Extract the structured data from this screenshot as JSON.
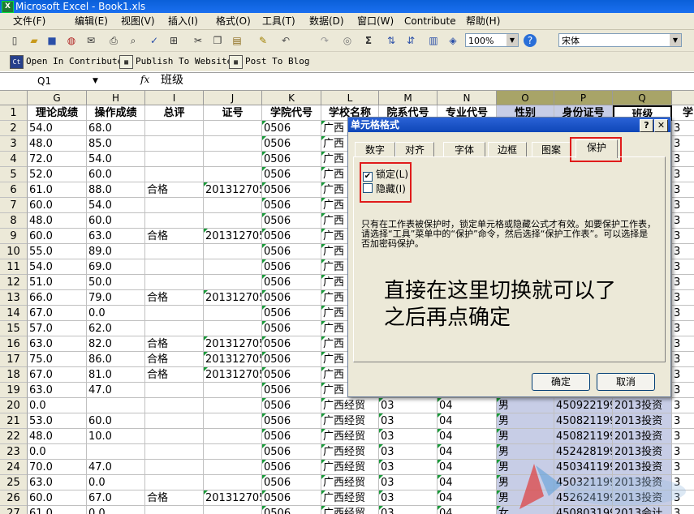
{
  "window": {
    "title": "Microsoft Excel - Book1.xls"
  },
  "menubar": [
    "文件(F)",
    "编辑(E)",
    "视图(V)",
    "插入(I)",
    "格式(O)",
    "工具(T)",
    "数据(D)",
    "窗口(W)",
    "Contribute",
    "帮助(H)"
  ],
  "toolbar": {
    "zoom": "100%",
    "font": "宋体",
    "contribute_buttons": [
      "Open In Contribute",
      "Publish To Website",
      "Post To Blog"
    ]
  },
  "formula_bar": {
    "name_box": "Q1",
    "fx": "fx",
    "value": "班级"
  },
  "grid": {
    "columns": [
      "G",
      "H",
      "I",
      "J",
      "K",
      "L",
      "M",
      "N",
      "O",
      "P",
      "Q"
    ],
    "header_row": [
      "理论成绩",
      "操作成绩",
      "总评",
      "证号",
      "学院代号",
      "学校名称",
      "院系代号",
      "专业代号",
      "性别",
      "身份证号",
      "班级"
    ],
    "rows": [
      {
        "n": "2",
        "c": [
          "54.0",
          "68.0",
          "",
          "",
          "0506",
          "广西",
          "",
          "",
          "",
          "",
          ""
        ]
      },
      {
        "n": "3",
        "c": [
          "48.0",
          "85.0",
          "",
          "",
          "0506",
          "广西",
          "",
          "",
          "",
          "",
          ""
        ]
      },
      {
        "n": "4",
        "c": [
          "72.0",
          "54.0",
          "",
          "",
          "0506",
          "广西",
          "",
          "",
          "",
          "",
          ""
        ]
      },
      {
        "n": "5",
        "c": [
          "52.0",
          "60.0",
          "",
          "",
          "0506",
          "广西",
          "",
          "",
          "",
          "",
          ""
        ]
      },
      {
        "n": "6",
        "c": [
          "61.0",
          "88.0",
          "合格",
          "201312705",
          "0506",
          "广西",
          "",
          "",
          "",
          "",
          ""
        ]
      },
      {
        "n": "7",
        "c": [
          "60.0",
          "54.0",
          "",
          "",
          "0506",
          "广西",
          "",
          "",
          "",
          "",
          ""
        ]
      },
      {
        "n": "8",
        "c": [
          "48.0",
          "60.0",
          "",
          "",
          "0506",
          "广西",
          "",
          "",
          "",
          "",
          ""
        ]
      },
      {
        "n": "9",
        "c": [
          "60.0",
          "63.0",
          "合格",
          "201312705",
          "0506",
          "广西",
          "",
          "",
          "",
          "",
          ""
        ]
      },
      {
        "n": "10",
        "c": [
          "55.0",
          "89.0",
          "",
          "",
          "0506",
          "广西",
          "",
          "",
          "",
          "",
          ""
        ]
      },
      {
        "n": "11",
        "c": [
          "54.0",
          "69.0",
          "",
          "",
          "0506",
          "广西",
          "",
          "",
          "",
          "",
          ""
        ]
      },
      {
        "n": "12",
        "c": [
          "51.0",
          "50.0",
          "",
          "",
          "0506",
          "广西",
          "",
          "",
          "",
          "",
          ""
        ]
      },
      {
        "n": "13",
        "c": [
          "66.0",
          "79.0",
          "合格",
          "201312705",
          "0506",
          "广西",
          "",
          "",
          "",
          "",
          ""
        ]
      },
      {
        "n": "14",
        "c": [
          "67.0",
          "0.0",
          "",
          "",
          "0506",
          "广西",
          "",
          "",
          "",
          "",
          ""
        ]
      },
      {
        "n": "15",
        "c": [
          "57.0",
          "62.0",
          "",
          "",
          "0506",
          "广西",
          "",
          "",
          "",
          "",
          ""
        ]
      },
      {
        "n": "16",
        "c": [
          "63.0",
          "82.0",
          "合格",
          "201312705",
          "0506",
          "广西",
          "",
          "",
          "",
          "",
          ""
        ]
      },
      {
        "n": "17",
        "c": [
          "75.0",
          "86.0",
          "合格",
          "201312705",
          "0506",
          "广西",
          "",
          "",
          "",
          "",
          ""
        ]
      },
      {
        "n": "18",
        "c": [
          "67.0",
          "81.0",
          "合格",
          "201312705",
          "0506",
          "广西",
          "",
          "",
          "",
          "",
          ""
        ]
      },
      {
        "n": "19",
        "c": [
          "63.0",
          "47.0",
          "",
          "",
          "0506",
          "广西",
          "",
          "",
          "",
          "",
          ""
        ]
      },
      {
        "n": "20",
        "c": [
          "0.0",
          "",
          "",
          "",
          "0506",
          "广西经贸",
          "03",
          "04",
          "男",
          "450922199",
          "2013投资"
        ]
      },
      {
        "n": "21",
        "c": [
          "53.0",
          "60.0",
          "",
          "",
          "0506",
          "广西经贸",
          "03",
          "04",
          "男",
          "450821199",
          "2013投资"
        ]
      },
      {
        "n": "22",
        "c": [
          "48.0",
          "10.0",
          "",
          "",
          "0506",
          "广西经贸",
          "03",
          "04",
          "男",
          "450821199",
          "2013投资"
        ]
      },
      {
        "n": "23",
        "c": [
          "0.0",
          "",
          "",
          "",
          "0506",
          "广西经贸",
          "03",
          "04",
          "男",
          "452428199",
          "2013投资"
        ]
      },
      {
        "n": "24",
        "c": [
          "70.0",
          "47.0",
          "",
          "",
          "0506",
          "广西经贸",
          "03",
          "04",
          "男",
          "450341199",
          "2013投资"
        ]
      },
      {
        "n": "25",
        "c": [
          "63.0",
          "0.0",
          "",
          "",
          "0506",
          "广西经贸",
          "03",
          "04",
          "男",
          "450321199",
          "2013投资"
        ]
      },
      {
        "n": "26",
        "c": [
          "60.0",
          "67.0",
          "合格",
          "201312705",
          "0506",
          "广西经贸",
          "03",
          "04",
          "男",
          "452624199",
          "2013投资"
        ]
      },
      {
        "n": "27",
        "c": [
          "61.0",
          "0.0",
          "",
          "",
          "0506",
          "广西经贸",
          "03",
          "04",
          "女",
          "450803199",
          "2013会计"
        ]
      }
    ],
    "right_edge_char": "学",
    "right_edge_digit": "3"
  },
  "dialog": {
    "title": "单元格格式",
    "help": "?",
    "close": "✕",
    "tabs": [
      "数字",
      "对齐",
      "字体",
      "边框",
      "图案",
      "保护"
    ],
    "active_tab": "保护",
    "checkboxes": [
      {
        "label": "锁定(L)",
        "checked": true
      },
      {
        "label": "隐藏(I)",
        "checked": false
      }
    ],
    "info": "只有在工作表被保护时，锁定单元格或隐藏公式才有效。如要保护工作表，请选择“工具”菜单中的“保护”命令，然后选择“保护工作表”。可以选择是否加密码保护。",
    "annotation_line1": "直接在这里切换就可以了",
    "annotation_line2": "之后再点确定",
    "ok": "确定",
    "cancel": "取消"
  },
  "colors": {
    "accent_red": "#e01b1b",
    "selected_col": "#c7cde6",
    "title_blue": "#0a5fd8"
  }
}
